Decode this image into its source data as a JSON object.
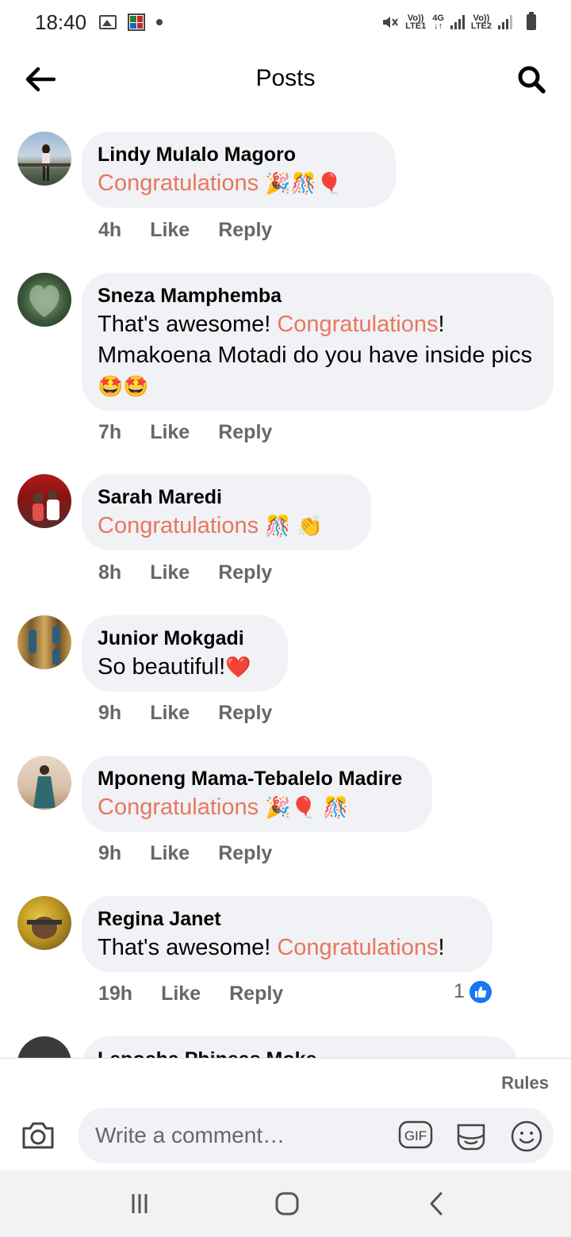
{
  "status_bar": {
    "time": "18:40",
    "sim1": "LTE1",
    "sim2": "LTE2",
    "network": "4G",
    "volte": "Vo))"
  },
  "header": {
    "title": "Posts",
    "back_icon": "arrow-left-icon",
    "search_icon": "search-icon"
  },
  "colors": {
    "highlight": "#e9765f",
    "bubble": "#f0f2f5",
    "meta": "#65676b",
    "like_blue": "#1877f2"
  },
  "comments": [
    {
      "name": "Lindy Mulalo Magoro",
      "text_before": "",
      "highlight": "Congratulations",
      "text_after": " ",
      "emojis": "🎉🎊🎈",
      "time": "4h",
      "like": "Like",
      "reply": "Reply"
    },
    {
      "name": "Sneza Mamphemba",
      "text_before": "That's awesome! ",
      "highlight": "Congratulations",
      "text_after": "! Mmakoena Motadi do you have inside pics ",
      "emojis": "🤩🤩",
      "time": "7h",
      "like": "Like",
      "reply": "Reply"
    },
    {
      "name": "Sarah Maredi",
      "text_before": "",
      "highlight": "Congratulations",
      "text_after": " ",
      "emojis": "🎊 👏",
      "time": "8h",
      "like": "Like",
      "reply": "Reply"
    },
    {
      "name": "Junior Mokgadi",
      "text_before": "So beautiful!",
      "highlight": "",
      "text_after": "",
      "emojis": "❤️",
      "time": "9h",
      "like": "Like",
      "reply": "Reply"
    },
    {
      "name": "Mponeng Mama-Tebalelo Madire",
      "text_before": "",
      "highlight": "Congratulations",
      "text_after": " ",
      "emojis": "🎉🎈 🎊",
      "time": "9h",
      "like": "Like",
      "reply": "Reply"
    },
    {
      "name": "Regina Janet",
      "text_before": "That's awesome! ",
      "highlight": "Congratulations",
      "text_after": "!",
      "emojis": "",
      "time": "19h",
      "like": "Like",
      "reply": "Reply",
      "reaction_count": "1"
    },
    {
      "name": "Lepocha Phineas Moke",
      "text_before": "",
      "highlight": "",
      "text_after": "",
      "emojis": "",
      "time": "",
      "like": "",
      "reply": ""
    }
  ],
  "composer": {
    "rules": "Rules",
    "placeholder": "Write a comment…",
    "gif_label": "GIF",
    "camera_icon": "camera-icon",
    "sticker_icon": "sticker-icon",
    "emoji_icon": "emoji-icon"
  },
  "navbar": {
    "recents_icon": "recent-apps-icon",
    "home_icon": "home-icon",
    "back_icon": "back-chevron-icon"
  }
}
